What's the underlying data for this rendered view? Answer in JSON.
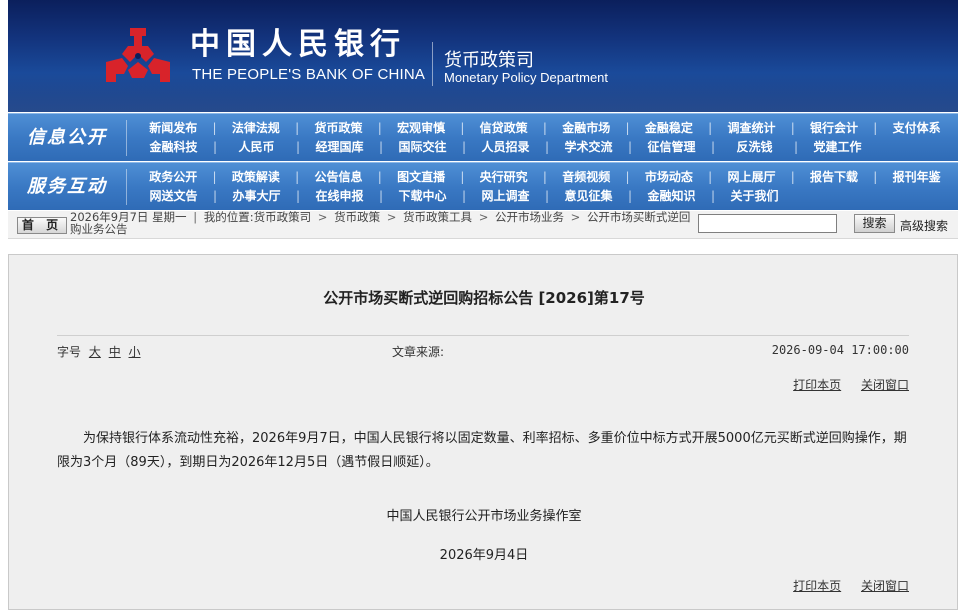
{
  "header": {
    "bank_name_cn": "中国人民银行",
    "bank_name_en": "THE PEOPLE'S BANK OF CHINA",
    "dept_name_cn": "货币政策司",
    "dept_name_en": "Monetary Policy Department",
    "emblem_icon": "pboc-emblem-icon",
    "emblem_color": "#d8232a"
  },
  "nav_info": {
    "title": "信息公开",
    "rows": [
      [
        "新闻发布",
        "法律法规",
        "货币政策",
        "宏观审慎",
        "信贷政策",
        "金融市场",
        "金融稳定",
        "调查统计",
        "银行会计",
        "支付体系"
      ],
      [
        "金融科技",
        "人民币",
        "经理国库",
        "国际交往",
        "人员招录",
        "学术交流",
        "征信管理",
        "反洗钱",
        "党建工作"
      ]
    ]
  },
  "nav_service": {
    "title": "服务互动",
    "rows": [
      [
        "政务公开",
        "政策解读",
        "公告信息",
        "图文直播",
        "央行研究",
        "音频视频",
        "市场动态",
        "网上展厅",
        "报告下载",
        "报刊年鉴"
      ],
      [
        "网送文告",
        "办事大厅",
        "在线申报",
        "下载中心",
        "网上调查",
        "意见征集",
        "金融知识",
        "关于我们"
      ]
    ]
  },
  "crumb": {
    "home_label": "首 页",
    "date": "2026年9月7日",
    "weekday": "星期一",
    "location_label": "我的位置:",
    "items": [
      "货币政策司",
      "货币政策",
      "货币政策工具",
      "公开市场业务",
      "公开市场买断式逆回购业务公告"
    ],
    "search_placeholder": "",
    "search_button": "搜索",
    "advanced_search": "高级搜索"
  },
  "article": {
    "title": "公开市场买断式逆回购招标公告 [2026]第17号",
    "font_size_label": "字号",
    "font_sizes": [
      "大",
      "中",
      "小"
    ],
    "source_label": "文章来源:",
    "publish_time": "2026-09-04 17:00:00",
    "print_label": "打印本页",
    "close_label": "关闭窗口",
    "body": "为保持银行体系流动性充裕，2026年9月7日，中国人民银行将以固定数量、利率招标、多重价位中标方式开展5000亿元买断式逆回购操作，期限为3个月（89天），到期日为2026年12月5日（遇节假日顺延）。",
    "signature": "中国人民银行公开市场业务操作室",
    "sign_date": "2026年9月4日"
  }
}
